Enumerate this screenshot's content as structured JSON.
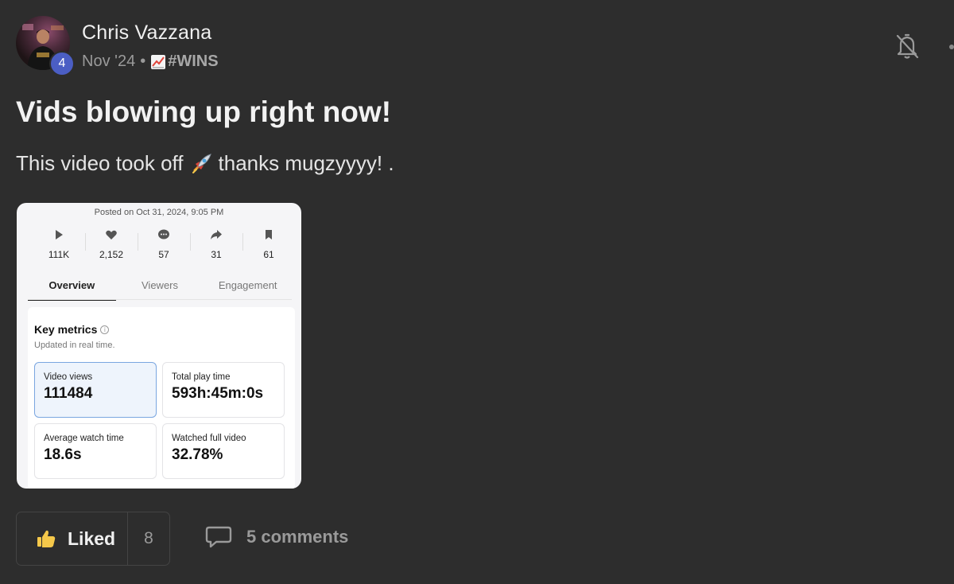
{
  "post": {
    "author": "Chris Vazzana",
    "level": "4",
    "date": "Nov '24",
    "separator": "•",
    "category": "#WINS",
    "title": "Vids blowing up right now!",
    "body_before": "This video took off",
    "body_after": "thanks mugzyyyy! ."
  },
  "screenshot": {
    "posted": "Posted on Oct 31, 2024, 9:05 PM",
    "stats": [
      {
        "icon": "play-icon",
        "value": "111K"
      },
      {
        "icon": "heart-icon",
        "value": "2,152"
      },
      {
        "icon": "comment-icon",
        "value": "57"
      },
      {
        "icon": "share-icon",
        "value": "31"
      },
      {
        "icon": "bookmark-icon",
        "value": "61"
      }
    ],
    "tabs": [
      "Overview",
      "Viewers",
      "Engagement"
    ],
    "key_metrics_title": "Key metrics",
    "key_metrics_sub": "Updated in real time.",
    "metrics": [
      {
        "label": "Video views",
        "value": "111484"
      },
      {
        "label": "Total play time",
        "value": "593h:45m:0s"
      },
      {
        "label": "Average watch time",
        "value": "18.6s"
      },
      {
        "label": "Watched full video",
        "value": "32.78%"
      }
    ]
  },
  "actions": {
    "liked_label": "Liked",
    "like_count": "8",
    "comments_label": "5 comments"
  },
  "colors": {
    "background": "#2d2d2d",
    "badge": "#4b5ec4",
    "like_icon": "#f5c84a"
  }
}
